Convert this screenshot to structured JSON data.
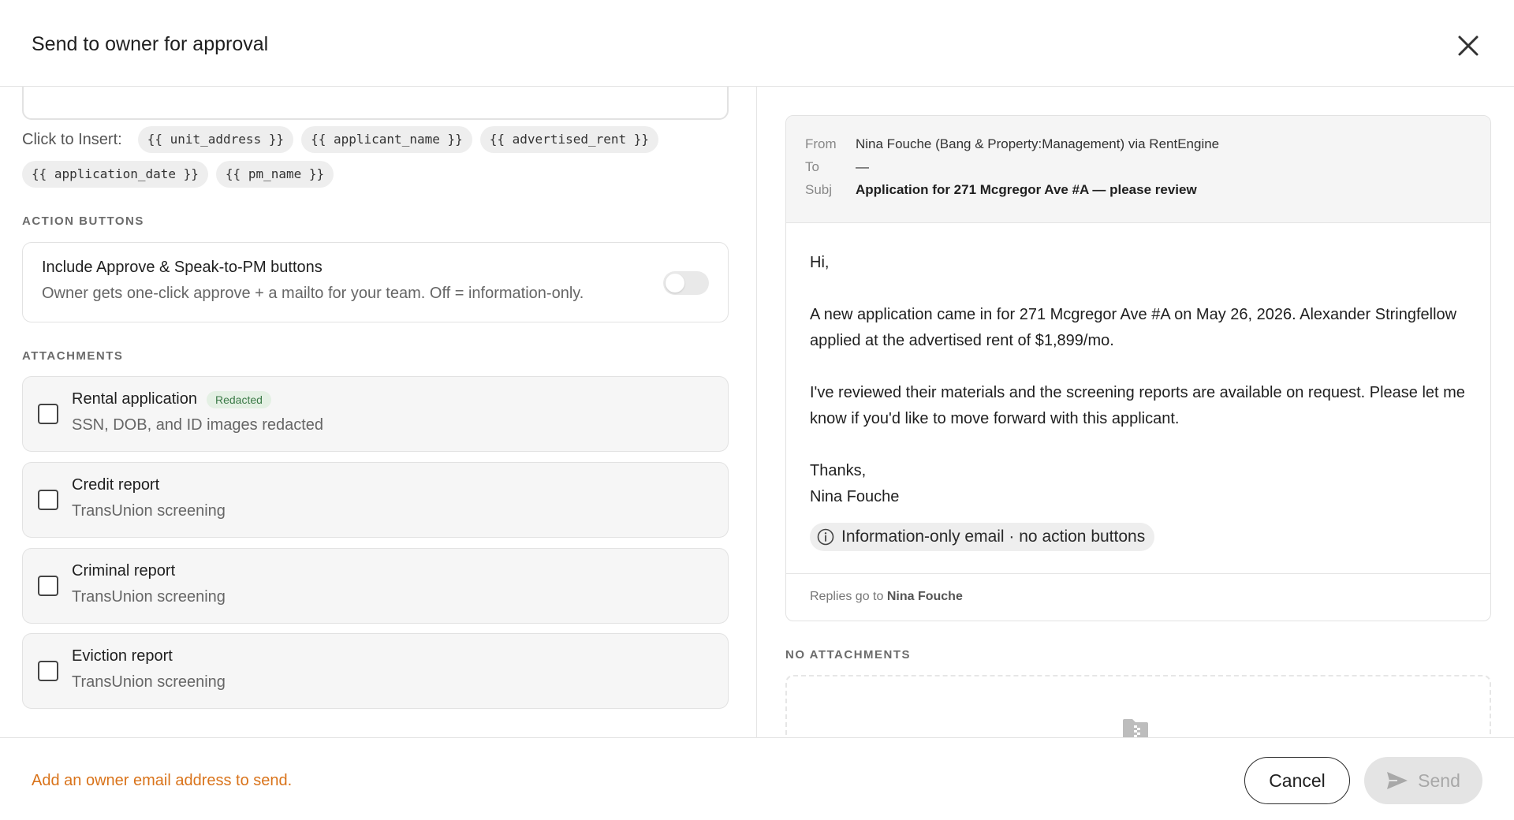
{
  "dialog": {
    "title": "Send to owner for approval"
  },
  "editor": {
    "insert_label": "Click to Insert:",
    "chips": [
      "{{ unit_address }}",
      "{{ applicant_name }}",
      "{{ advertised_rent }}",
      "{{ application_date }}",
      "{{ pm_name }}"
    ]
  },
  "action_buttons": {
    "section_label": "ACTION BUTTONS",
    "title": "Include Approve & Speak-to-PM buttons",
    "subtitle": "Owner gets one-click approve + a mailto for your team. Off = information-only.",
    "enabled": false
  },
  "attachments": {
    "section_label": "ATTACHMENTS",
    "items": [
      {
        "title": "Rental application",
        "badge": "Redacted",
        "subtitle": "SSN, DOB, and ID images redacted",
        "checked": false
      },
      {
        "title": "Credit report",
        "badge": "",
        "subtitle": "TransUnion screening",
        "checked": false
      },
      {
        "title": "Criminal report",
        "badge": "",
        "subtitle": "TransUnion screening",
        "checked": false
      },
      {
        "title": "Eviction report",
        "badge": "",
        "subtitle": "TransUnion screening",
        "checked": false
      }
    ]
  },
  "preview": {
    "from_label": "From",
    "from_value": "Nina Fouche (Bang & Property:Management) via RentEngine",
    "to_label": "To",
    "to_value": "—",
    "subj_label": "Subj",
    "subj_value": "Application for 271 Mcgregor Ave #A — please review",
    "greeting": "Hi,",
    "paragraph1": "A new application came in for 271 Mcgregor Ave #A on May 26, 2026. Alexander Stringfellow applied at the advertised rent of $1,899/mo.",
    "paragraph2": "I've reviewed their materials and the screening reports are available on request. Please let me know if you'd like to move forward with this applicant.",
    "signoff": "Thanks,",
    "signature": "Nina Fouche",
    "info_pill": "Information-only email · no action buttons",
    "replies_prefix": "Replies go to",
    "replies_name": "Nina Fouche",
    "no_attachments_label": "NO ATTACHMENTS"
  },
  "footer": {
    "warning": "Add an owner email address to send.",
    "cancel_label": "Cancel",
    "send_label": "Send"
  },
  "colors": {
    "warning": "#d9731a",
    "badge_bg": "#e4f0e4",
    "badge_text": "#3b7a47"
  },
  "icons": {
    "close": "close-icon",
    "info": "info-icon",
    "send": "send-icon",
    "zip": "zip-file-icon"
  }
}
